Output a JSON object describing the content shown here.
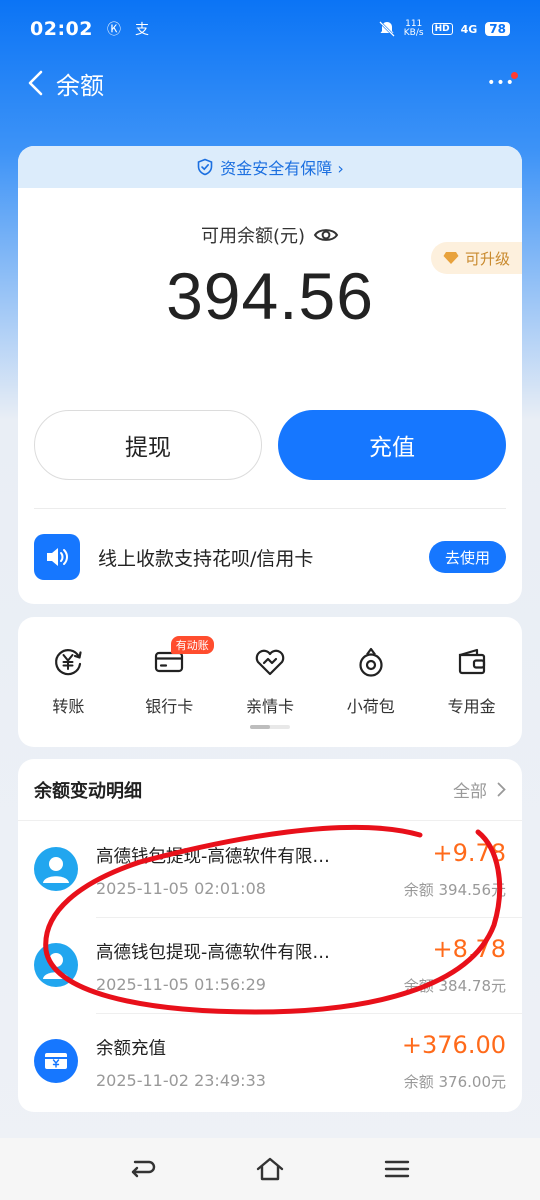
{
  "status_bar": {
    "time": "02:02",
    "glyph_a": "Ⓚ",
    "glyph_b": "支",
    "net_speed_value": "111",
    "net_speed_unit": "KB/s",
    "hd": "HD",
    "signal": "4G",
    "battery": "78"
  },
  "nav": {
    "title": "余额",
    "more": "•••"
  },
  "balance": {
    "safety_banner": "资金安全有保障 ›",
    "label": "可用余额(元)",
    "amount": "394.56",
    "upgrade": "可升级",
    "withdraw_label": "提现",
    "topup_label": "充值",
    "promo_text": "线上收款支持花呗/信用卡",
    "promo_button": "去使用"
  },
  "shortcuts": [
    {
      "label": "转账",
      "icon": "transfer-icon"
    },
    {
      "label": "银行卡",
      "icon": "bank-card-icon",
      "tag": "有动账"
    },
    {
      "label": "亲情卡",
      "icon": "family-card-icon"
    },
    {
      "label": "小荷包",
      "icon": "pouch-icon"
    },
    {
      "label": "专用金",
      "icon": "wallet-icon"
    }
  ],
  "transactions": {
    "title": "余额变动明细",
    "all": "全部",
    "items": [
      {
        "name": "高德钱包提现-高德软件有限公司…",
        "amount": "+9.78",
        "date": "2025-11-05 02:01:08",
        "balance": "余额 394.56元",
        "icon": "user-avatar-icon"
      },
      {
        "name": "高德钱包提现-高德软件有限公司…",
        "amount": "+8.78",
        "date": "2025-11-05 01:56:29",
        "balance": "余额 384.78元",
        "icon": "user-avatar-icon"
      },
      {
        "name": "余额充值",
        "amount": "+376.00",
        "date": "2025-11-02 23:49:33",
        "balance": "余额 376.00元",
        "icon": "topup-icon"
      }
    ]
  },
  "colors": {
    "primary": "#1677ff",
    "amount_positive": "#ff6a1a",
    "annotation": "#e8101a"
  }
}
